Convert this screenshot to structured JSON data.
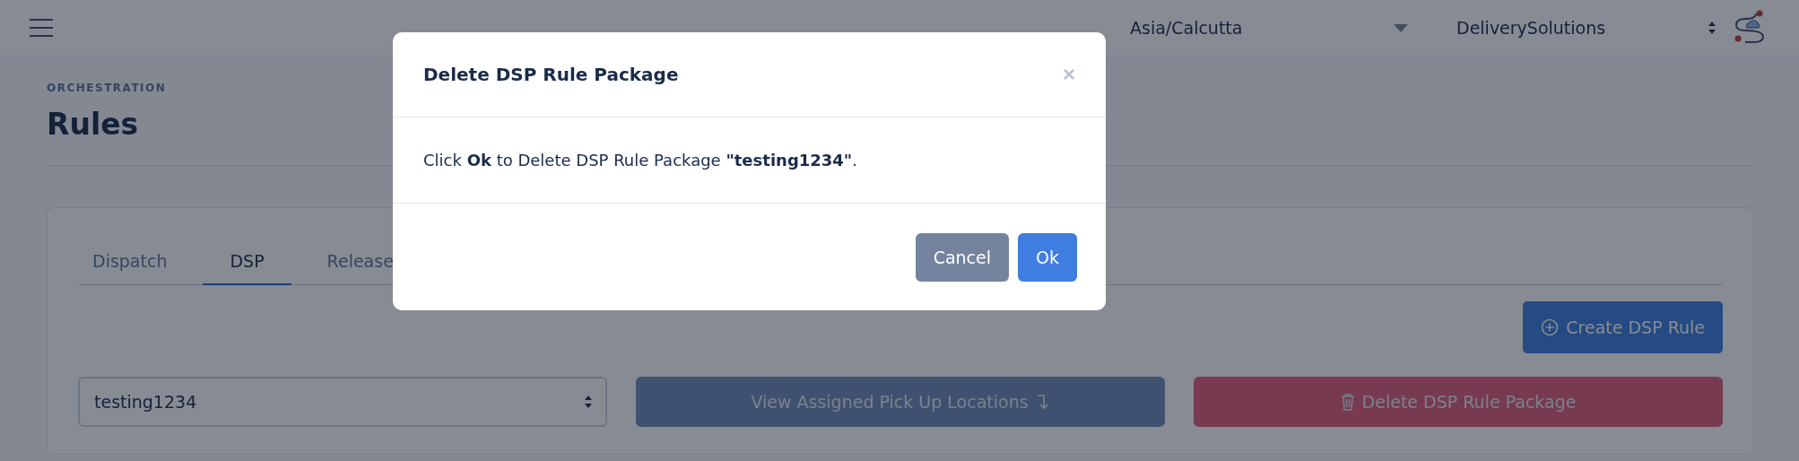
{
  "header": {
    "timezone": "Asia/Calcutta",
    "account": "DeliverySolutions"
  },
  "page": {
    "breadcrumb": "ORCHESTRATION",
    "title": "Rules"
  },
  "tabs": [
    {
      "label": "Dispatch",
      "selected": false
    },
    {
      "label": "DSP",
      "selected": true
    },
    {
      "label": "Release",
      "selected": false
    }
  ],
  "create_button": "Create DSP Rule",
  "package_select": {
    "value": "testing1234"
  },
  "view_button": "View Assigned Pick Up Locations",
  "delete_button": "Delete DSP Rule Package",
  "modal": {
    "title": "Delete DSP Rule Package",
    "close": "×",
    "message": "Click **Ok** to Delete DSP Rule Package **\"testing1234\"**.",
    "buttons": [
      {
        "label": "Cancel",
        "kind": "secondary"
      },
      {
        "label": "Ok",
        "kind": "primary"
      }
    ]
  }
}
